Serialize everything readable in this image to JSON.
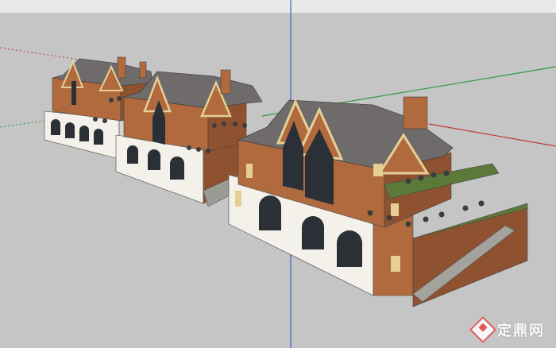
{
  "scene": {
    "background_color": "#c5c5c5",
    "sky_color": "#e9e9e9",
    "axis_colors": {
      "red": "#c0392b",
      "green": "#2e9b3e",
      "blue": "#3a5fcd"
    },
    "materials": {
      "brick": "#b06a3e",
      "brick_dark": "#8e5231",
      "roof": "#6e6b6a",
      "roof_dark": "#545150",
      "trim": "#e6cf95",
      "plaster": "#f3f1ea",
      "glass": "#2b3036",
      "grass": "#5b7a3a"
    }
  },
  "watermark": {
    "text": "定鼎网",
    "icon": "diamond-logo-icon"
  }
}
